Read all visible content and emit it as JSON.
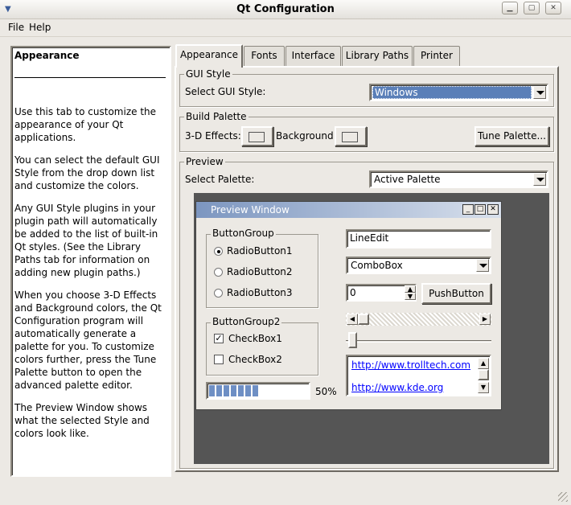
{
  "window": {
    "title": "Qt Configuration",
    "menu_icon": "window-menu-icon"
  },
  "menubar": {
    "file": "File",
    "help": "Help"
  },
  "help_panel": {
    "title": "Appearance",
    "paragraphs": [
      "Use this tab to customize the appearance of your Qt applications.",
      "You can select the default GUI Style from the drop down list and customize the colors.",
      "Any GUI Style plugins in your plugin path will automatically be added to the list of built-in Qt styles. (See the Library Paths tab for information on adding new plugin paths.)",
      "When you choose 3-D Effects and Background colors, the Qt Configuration program will automatically generate a palette for you. To customize colors further, press the Tune Palette button to open the advanced palette editor.",
      "The Preview Window shows what the selected Style and colors look like."
    ]
  },
  "tabs": [
    "Appearance",
    "Fonts",
    "Interface",
    "Library Paths",
    "Printer"
  ],
  "gui_style": {
    "group": "GUI Style",
    "label": "Select GUI Style:",
    "value": "Windows"
  },
  "build_palette": {
    "group": "Build Palette",
    "effects_label": "3-D Effects:",
    "background_label": "Background:",
    "tune_button": "Tune Palette..."
  },
  "preview": {
    "group": "Preview",
    "palette_label": "Select Palette:",
    "palette_value": "Active Palette",
    "window_title": "Preview Window",
    "button_group": {
      "title": "ButtonGroup",
      "radios": [
        "RadioButton1",
        "RadioButton2",
        "RadioButton3"
      ],
      "selected": 0
    },
    "button_group2": {
      "title": "ButtonGroup2",
      "checkboxes": [
        {
          "label": "CheckBox1",
          "checked": true
        },
        {
          "label": "CheckBox2",
          "checked": false
        }
      ]
    },
    "progress": {
      "value": 0.5,
      "label": "50%"
    },
    "line_edit": "LineEdit",
    "combo_box": "ComboBox",
    "spin_box": "0",
    "push_button": "PushButton",
    "links": [
      "http://www.trolltech.com",
      "http://www.kde.org"
    ]
  },
  "colors": {
    "titlebar_gradient_start": "#7c96c0",
    "selected_combo": "#5a7fb8",
    "preview_background": "#555555",
    "progress_fill": "#6e8fc4"
  }
}
